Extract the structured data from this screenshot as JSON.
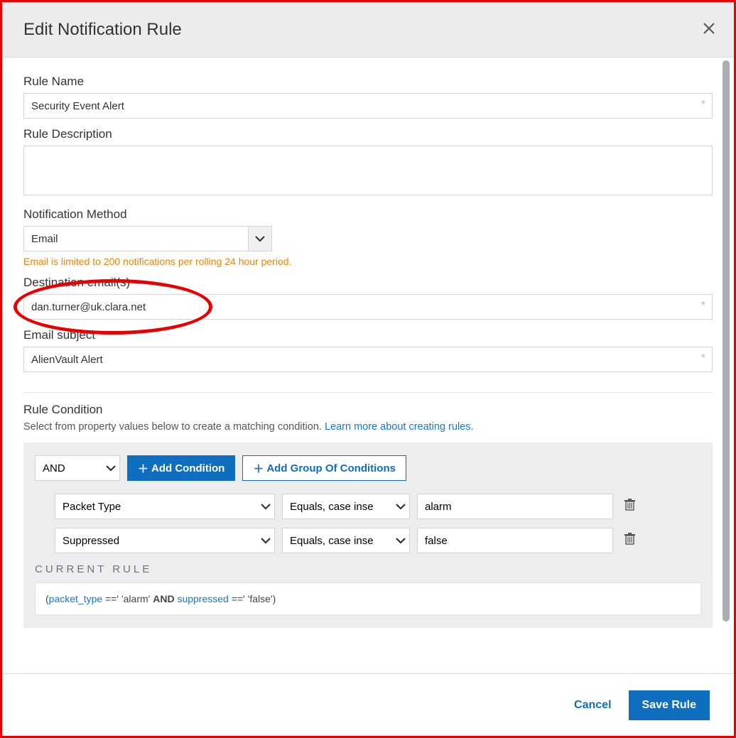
{
  "header": {
    "title": "Edit Notification Rule"
  },
  "fields": {
    "rule_name": {
      "label": "Rule Name",
      "value": "Security Event Alert"
    },
    "rule_description": {
      "label": "Rule Description",
      "value": ""
    },
    "notification_method": {
      "label": "Notification Method",
      "value": "Email",
      "warning": "Email is limited to 200 notifications per rolling 24 hour period."
    },
    "destination_emails": {
      "label": "Destination email(s)",
      "value": "dan.turner@uk.clara.net"
    },
    "email_subject": {
      "label": "Email subject",
      "value": "AlienVault Alert"
    }
  },
  "rule_condition": {
    "heading": "Rule Condition",
    "sub": "Select from property values below to create a matching condition. ",
    "link": "Learn more about creating rules.",
    "logic": "AND",
    "btn_add_condition": "Add Condition",
    "btn_add_group": "Add Group Of Conditions",
    "rows": [
      {
        "field": "Packet Type",
        "op": "Equals, case inse",
        "value": "alarm"
      },
      {
        "field": "Suppressed",
        "op": "Equals, case inse",
        "value": "false"
      }
    ],
    "current_rule_label": "CURRENT RULE",
    "current_rule": {
      "key1": "packet_type",
      "lit1": " ==' 'alarm' ",
      "and": "AND",
      "key2": " suppressed",
      "lit2": " ==' 'false')"
    }
  },
  "footer": {
    "cancel": "Cancel",
    "save": "Save Rule"
  }
}
